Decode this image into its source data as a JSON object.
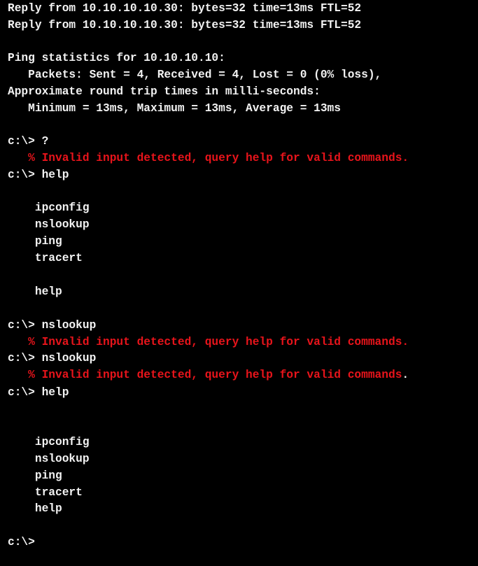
{
  "terminal": {
    "colors": {
      "background": "#000000",
      "text": "#f2f2f2",
      "error": "#e8141b"
    },
    "lines": [
      {
        "text": "Reply from 10.10.10.10.30: bytes=32 time=13ms FTL=52",
        "type": "output"
      },
      {
        "text": "Reply from 10.10.10.10.30: bytes=32 time=13ms FTL=52",
        "type": "output"
      },
      {
        "text": "",
        "type": "blank"
      },
      {
        "text": "Ping statistics for 10.10.10.10:",
        "type": "output"
      },
      {
        "text": "   Packets: Sent = 4, Received = 4, Lost = 0 (0% loss),",
        "type": "output"
      },
      {
        "text": "Approximate round trip times in milli-seconds:",
        "type": "output"
      },
      {
        "text": "   Minimum = 13ms, Maximum = 13ms, Average = 13ms",
        "type": "output"
      },
      {
        "text": "",
        "type": "blank"
      },
      {
        "text": "c:\\> ?",
        "type": "command"
      },
      {
        "text": "   % Invalid input detected, query help for valid commands.",
        "type": "error"
      },
      {
        "text": "c:\\> help",
        "type": "command"
      },
      {
        "text": "",
        "type": "blank"
      },
      {
        "text": "    ipconfig",
        "type": "output"
      },
      {
        "text": "    nslookup",
        "type": "output"
      },
      {
        "text": "    ping",
        "type": "output"
      },
      {
        "text": "    tracert",
        "type": "output"
      },
      {
        "text": "",
        "type": "blank"
      },
      {
        "text": "    help",
        "type": "output"
      },
      {
        "text": "",
        "type": "blank"
      },
      {
        "text": "c:\\> nslookup",
        "type": "command"
      },
      {
        "text": "   % Invalid input detected, query help for valid commands.",
        "type": "error"
      },
      {
        "text": "c:\\> nslookup",
        "type": "command"
      },
      {
        "text": "   % Invalid input detected, query help for valid commands",
        "type": "error",
        "suffix": "."
      },
      {
        "text": "c:\\> help",
        "type": "command"
      },
      {
        "text": "",
        "type": "blank"
      },
      {
        "text": "",
        "type": "blank"
      },
      {
        "text": "    ipconfig",
        "type": "output"
      },
      {
        "text": "    nslookup",
        "type": "output"
      },
      {
        "text": "    ping",
        "type": "output"
      },
      {
        "text": "    tracert",
        "type": "output"
      },
      {
        "text": "    help",
        "type": "output"
      },
      {
        "text": "",
        "type": "blank"
      },
      {
        "text": "c:\\>",
        "type": "prompt"
      }
    ]
  }
}
